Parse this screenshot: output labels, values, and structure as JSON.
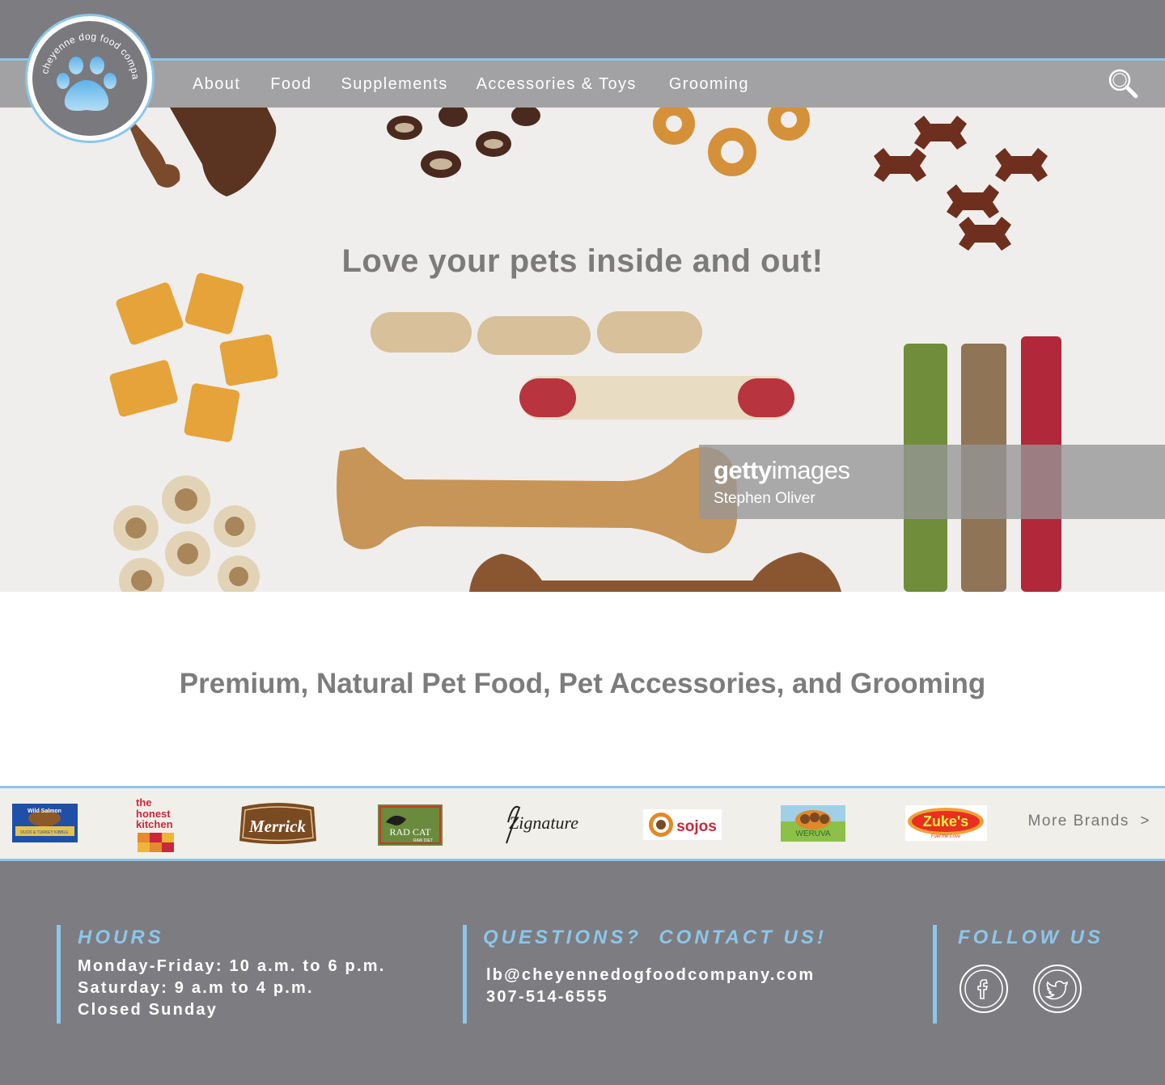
{
  "brand": {
    "name": "cheyenne dog food company"
  },
  "nav": {
    "items": [
      {
        "label": "About"
      },
      {
        "label": "Food"
      },
      {
        "label": "Supplements"
      },
      {
        "label": "Accessories & Toys"
      },
      {
        "label": "Grooming"
      }
    ],
    "search_icon": "search-icon"
  },
  "hero": {
    "title": "Love your pets inside and out!",
    "watermark_brand_a": "getty",
    "watermark_brand_b": "images",
    "watermark_credit": "Stephen Oliver"
  },
  "tagline": "Premium, Natural Pet Food, Pet Accessories, and Grooming",
  "brands": {
    "logos": [
      {
        "name": "Wild Salmon",
        "caption": "DUCK & TURKEY KIBBLE"
      },
      {
        "name": "the honest kitchen",
        "line1": "the",
        "line2": "honest",
        "line3": "kitchen"
      },
      {
        "name": "Merrick"
      },
      {
        "name": "RAD CAT",
        "caption": "RAW DIET"
      },
      {
        "name": "Zignature"
      },
      {
        "name": "sojos"
      },
      {
        "name": "WERUVA"
      },
      {
        "name": "Zuke's",
        "caption": "Fuel the Love"
      }
    ],
    "more_label": "More Brands",
    "more_chevron": ">"
  },
  "footer": {
    "hours": {
      "heading": "HOURS",
      "lines": [
        "Monday-Friday: 10 a.m. to 6 p.m.",
        "Saturday: 9 a.m to 4 p.m.",
        "Closed Sunday"
      ]
    },
    "contact": {
      "heading": "QUESTIONS?  CONTACT US!",
      "email": "lb@cheyennedogfoodcompany.com",
      "phone": "307-514-6555"
    },
    "follow": {
      "heading": "FOLLOW US",
      "icons": [
        "facebook-icon",
        "twitter-icon"
      ]
    }
  },
  "colors": {
    "accent": "#8cc6ea",
    "header_gray": "#7d7c80",
    "nav_gray": "#a2a2a4",
    "text_gray": "#7b7b7b"
  }
}
